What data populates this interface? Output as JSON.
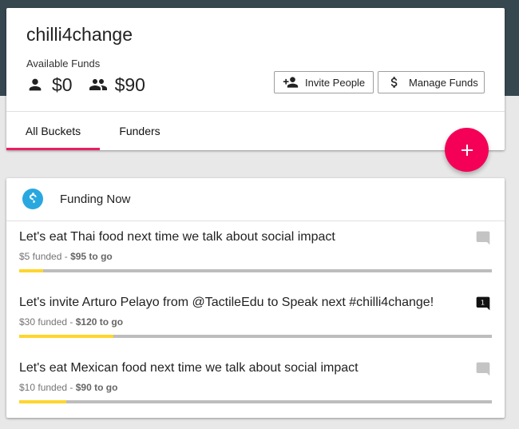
{
  "group": {
    "name": "chilli4change",
    "funds_label": "Available Funds",
    "personal_funds": "$0",
    "group_funds": "$90"
  },
  "buttons": {
    "invite": "Invite People",
    "manage": "Manage Funds"
  },
  "tabs": [
    {
      "label": "All Buckets",
      "active": true
    },
    {
      "label": "Funders",
      "active": false
    }
  ],
  "section": {
    "title": "Funding Now"
  },
  "buckets": [
    {
      "title": "Let's eat Thai food next time we talk about social impact",
      "funded": "$5 funded",
      "separator": " - ",
      "to_go": "$95 to go",
      "progress": 0.05,
      "comments": null
    },
    {
      "title": "Let's invite Arturo Pelayo from @TactileEdu to Speak next #chilli4change!",
      "funded": "$30 funded",
      "separator": " - ",
      "to_go": "$120 to go",
      "progress": 0.2,
      "comments": "1"
    },
    {
      "title": "Let's eat Mexican food next time we talk about social impact",
      "funded": "$10 funded",
      "separator": " - ",
      "to_go": "$90 to go",
      "progress": 0.1,
      "comments": null
    }
  ],
  "colors": {
    "accent": "#e91e63",
    "fab": "#f50057",
    "progress_fill": "#ffd52e",
    "progress_track": "#bdbdbd",
    "header_bg": "#37474f",
    "dollar_icon": "#29a8e0"
  },
  "icons": {
    "person": "person-icon",
    "group": "group-icon",
    "add_person": "person-add-icon",
    "dollar": "dollar-icon",
    "add": "add-icon",
    "comment": "comment-icon"
  }
}
